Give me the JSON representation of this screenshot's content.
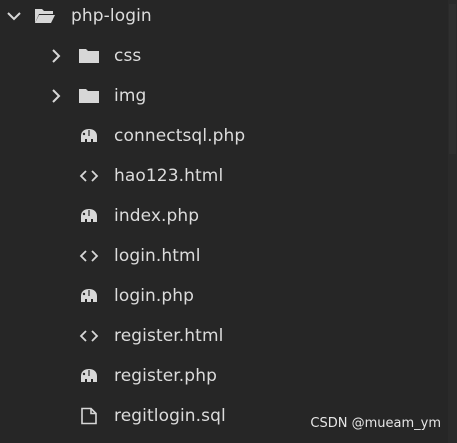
{
  "tree": {
    "root": {
      "label": "php-login",
      "expanded": true,
      "icon": "folder-open-icon"
    },
    "items": [
      {
        "label": "css",
        "type": "folder",
        "icon": "folder-icon"
      },
      {
        "label": "img",
        "type": "folder",
        "icon": "folder-icon"
      },
      {
        "label": "connectsql.php",
        "type": "php",
        "icon": "php-elephant-icon"
      },
      {
        "label": "hao123.html",
        "type": "html",
        "icon": "code-brackets-icon"
      },
      {
        "label": "index.php",
        "type": "php",
        "icon": "php-elephant-icon"
      },
      {
        "label": "login.html",
        "type": "html",
        "icon": "code-brackets-icon"
      },
      {
        "label": "login.php",
        "type": "php",
        "icon": "php-elephant-icon"
      },
      {
        "label": "register.html",
        "type": "html",
        "icon": "code-brackets-icon"
      },
      {
        "label": "register.php",
        "type": "php",
        "icon": "php-elephant-icon"
      },
      {
        "label": "regitlogin.sql",
        "type": "sql",
        "icon": "file-icon"
      }
    ]
  },
  "watermark": "CSDN @mueam_ym",
  "colors": {
    "background": "#262626",
    "text": "#dcdcdc",
    "icon": "#d7d7d7"
  }
}
